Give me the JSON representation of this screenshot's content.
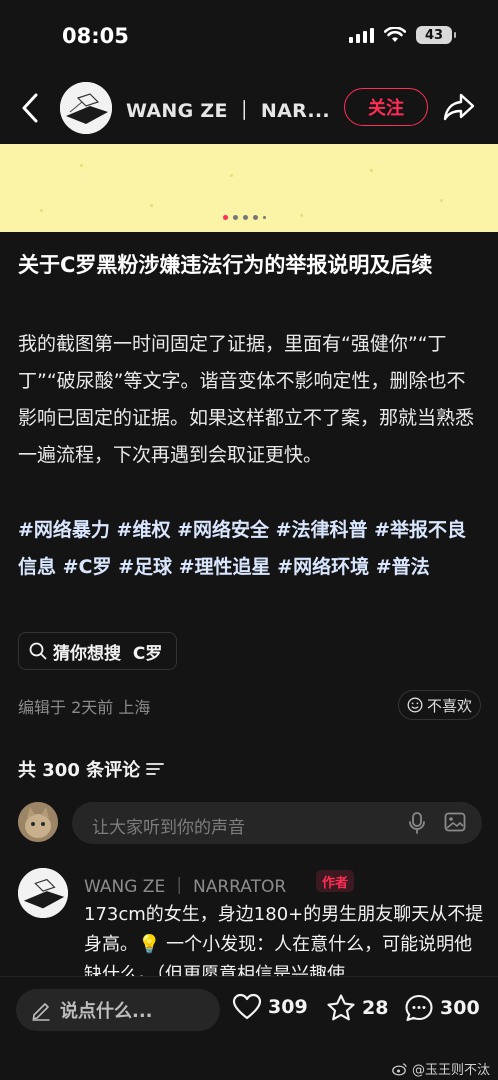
{
  "status_bar": {
    "time": "08:05",
    "battery": "43"
  },
  "header": {
    "author": "WANG ZE ｜ NAR...",
    "follow_label": "关注"
  },
  "post": {
    "title": "关于C罗黑粉涉嫌违法行为的举报说明及后续",
    "body": "我的截图第一时间固定了证据，里面有“强健你”“丁丁”“破尿酸”等文字。谐音变体不影响定性，删除也不影响已固定的证据。如果这样都立不了案，那就当熟悉一遍流程，下次再遇到会取证更快。",
    "tags": "#网络暴力 #维权 #网络安全 #法律科普 #举报不良信息 #C罗 #足球 #理性追星 #网络环境 #普法",
    "guess_search": "猜你想搜  C罗",
    "edit_meta": "编辑于 2天前 上海",
    "dislike_label": "不喜欢"
  },
  "comments_section": {
    "count_label": "共 300 条评论",
    "input_placeholder": "让大家听到你的声音"
  },
  "comment": {
    "name": "WANG ZE ｜ NARRATOR",
    "badge": "作者",
    "text": "173cm的女生，身边180+的男生朋友聊天从不提身高。💡 一个小发现：人在意什么，可能说明他缺什么。（但更愿意相信是兴趣使"
  },
  "bottom_bar": {
    "say_placeholder": "说点什么...",
    "likes": "309",
    "favorites": "28",
    "comments": "300"
  },
  "watermark": "@玉王则不汰"
}
